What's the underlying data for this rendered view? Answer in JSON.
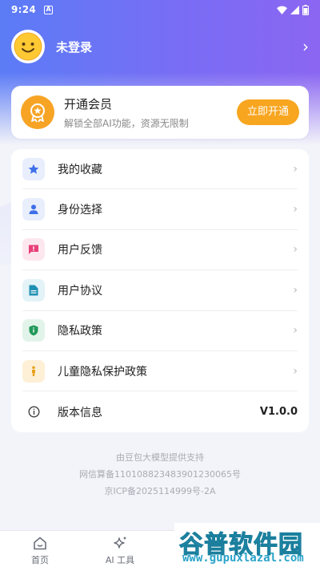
{
  "status_bar": {
    "time": "9:24",
    "notification": "A"
  },
  "profile": {
    "name": "未登录",
    "arrow": "›"
  },
  "vip": {
    "title": "开通会员",
    "subtitle": "解锁全部AI功能，资源无限制",
    "button": "立即开通",
    "badge_color": "#f7a425"
  },
  "menu": {
    "items": [
      {
        "label": "我的收藏",
        "icon": "star-icon"
      },
      {
        "label": "身份选择",
        "icon": "person-icon"
      },
      {
        "label": "用户反馈",
        "icon": "feedback-icon"
      },
      {
        "label": "用户协议",
        "icon": "document-icon"
      },
      {
        "label": "隐私政策",
        "icon": "shield-icon"
      },
      {
        "label": "儿童隐私保护政策",
        "icon": "child-icon"
      },
      {
        "label": "版本信息",
        "icon": "info-icon",
        "value": "V1.0.0"
      }
    ],
    "arrow": "›"
  },
  "footer": {
    "line1": "由豆包大模型提供支持",
    "line2": "网信算备110108823483901230065号",
    "line3": "京ICP备2025114999号-2A"
  },
  "tabs": [
    {
      "label": "首页",
      "icon": "home-icon"
    },
    {
      "label": "AI 工具",
      "icon": "sparkle-icon"
    }
  ],
  "watermark": {
    "title": "谷普软件园",
    "url": "www.gupuxlazal.com"
  }
}
